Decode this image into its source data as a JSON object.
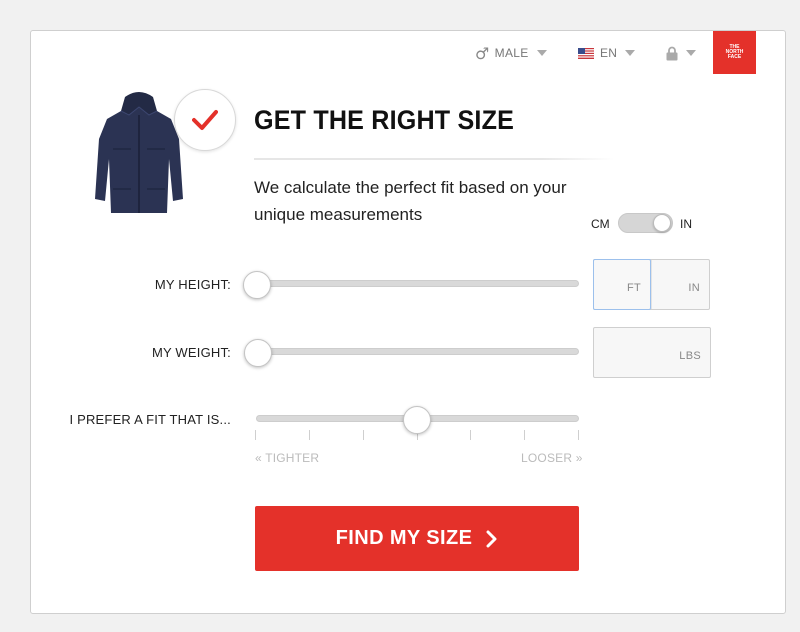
{
  "header": {
    "gender": {
      "label": "MALE",
      "icon": "male-symbol-icon"
    },
    "language": {
      "label": "EN",
      "icon": "us-flag-icon"
    },
    "account": {
      "icon": "lock-icon"
    },
    "brand": {
      "line1": "THE",
      "line2": "NORTH",
      "line3": "FACE",
      "color": "#e4312a"
    }
  },
  "hero": {
    "image": "jacket-image",
    "badge_icon": "checkmark-icon",
    "title": "GET THE RIGHT SIZE",
    "subtitle": "We calculate the perfect fit based on your unique measurements"
  },
  "units": {
    "left": "CM",
    "right": "IN",
    "selected": "IN"
  },
  "height": {
    "label": "MY HEIGHT:",
    "slider_value": 0,
    "ft_placeholder": "FT",
    "in_placeholder": "IN"
  },
  "weight": {
    "label": "MY WEIGHT:",
    "slider_value": 0,
    "lbs_placeholder": "LBS"
  },
  "fit": {
    "label": "I PREFER A FIT THAT IS...",
    "slider_value": 0.5,
    "tick_count": 7,
    "left_hint": "« TIGHTER",
    "right_hint": "LOOSER »"
  },
  "cta": {
    "label": "FIND MY SIZE",
    "icon": "chevron-right-icon",
    "color": "#e4312a"
  }
}
